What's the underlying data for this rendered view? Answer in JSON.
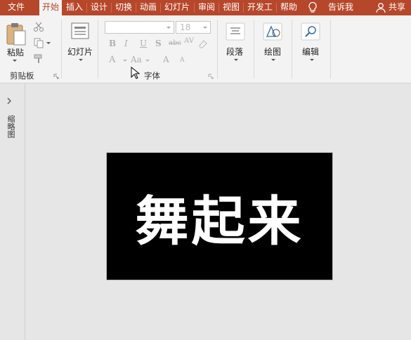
{
  "tabs": [
    {
      "label": "文件"
    },
    {
      "label": "开始"
    },
    {
      "label": "插入"
    },
    {
      "label": "设计"
    },
    {
      "label": "切换"
    },
    {
      "label": "动画"
    },
    {
      "label": "幻灯片"
    },
    {
      "label": "审阅"
    },
    {
      "label": "视图"
    },
    {
      "label": "开发工"
    },
    {
      "label": "帮助"
    }
  ],
  "tell_me": "告诉我",
  "share": "共享",
  "ribbon": {
    "paste_label": "粘贴",
    "clipboard_group": "剪贴板",
    "slide_label": "幻灯片",
    "font_name_value": "",
    "font_size_value": "18",
    "font_group": "字体",
    "paragraph_label": "段落",
    "drawing_label": "绘图",
    "editing_label": "编辑",
    "format_buttons": [
      "B",
      "I",
      "U",
      "S",
      "abc",
      "AV",
      "A",
      "Aa",
      "A",
      "A"
    ]
  },
  "left_pane": {
    "thumbnails_label": "缩略图"
  },
  "slide": {
    "text": "舞起来",
    "background": "#000000",
    "text_color": "#ffffff"
  },
  "colors": {
    "accent": "#b7472a",
    "ribbon_bg": "#f3f3f3",
    "canvas_bg": "#e6e6e6"
  }
}
